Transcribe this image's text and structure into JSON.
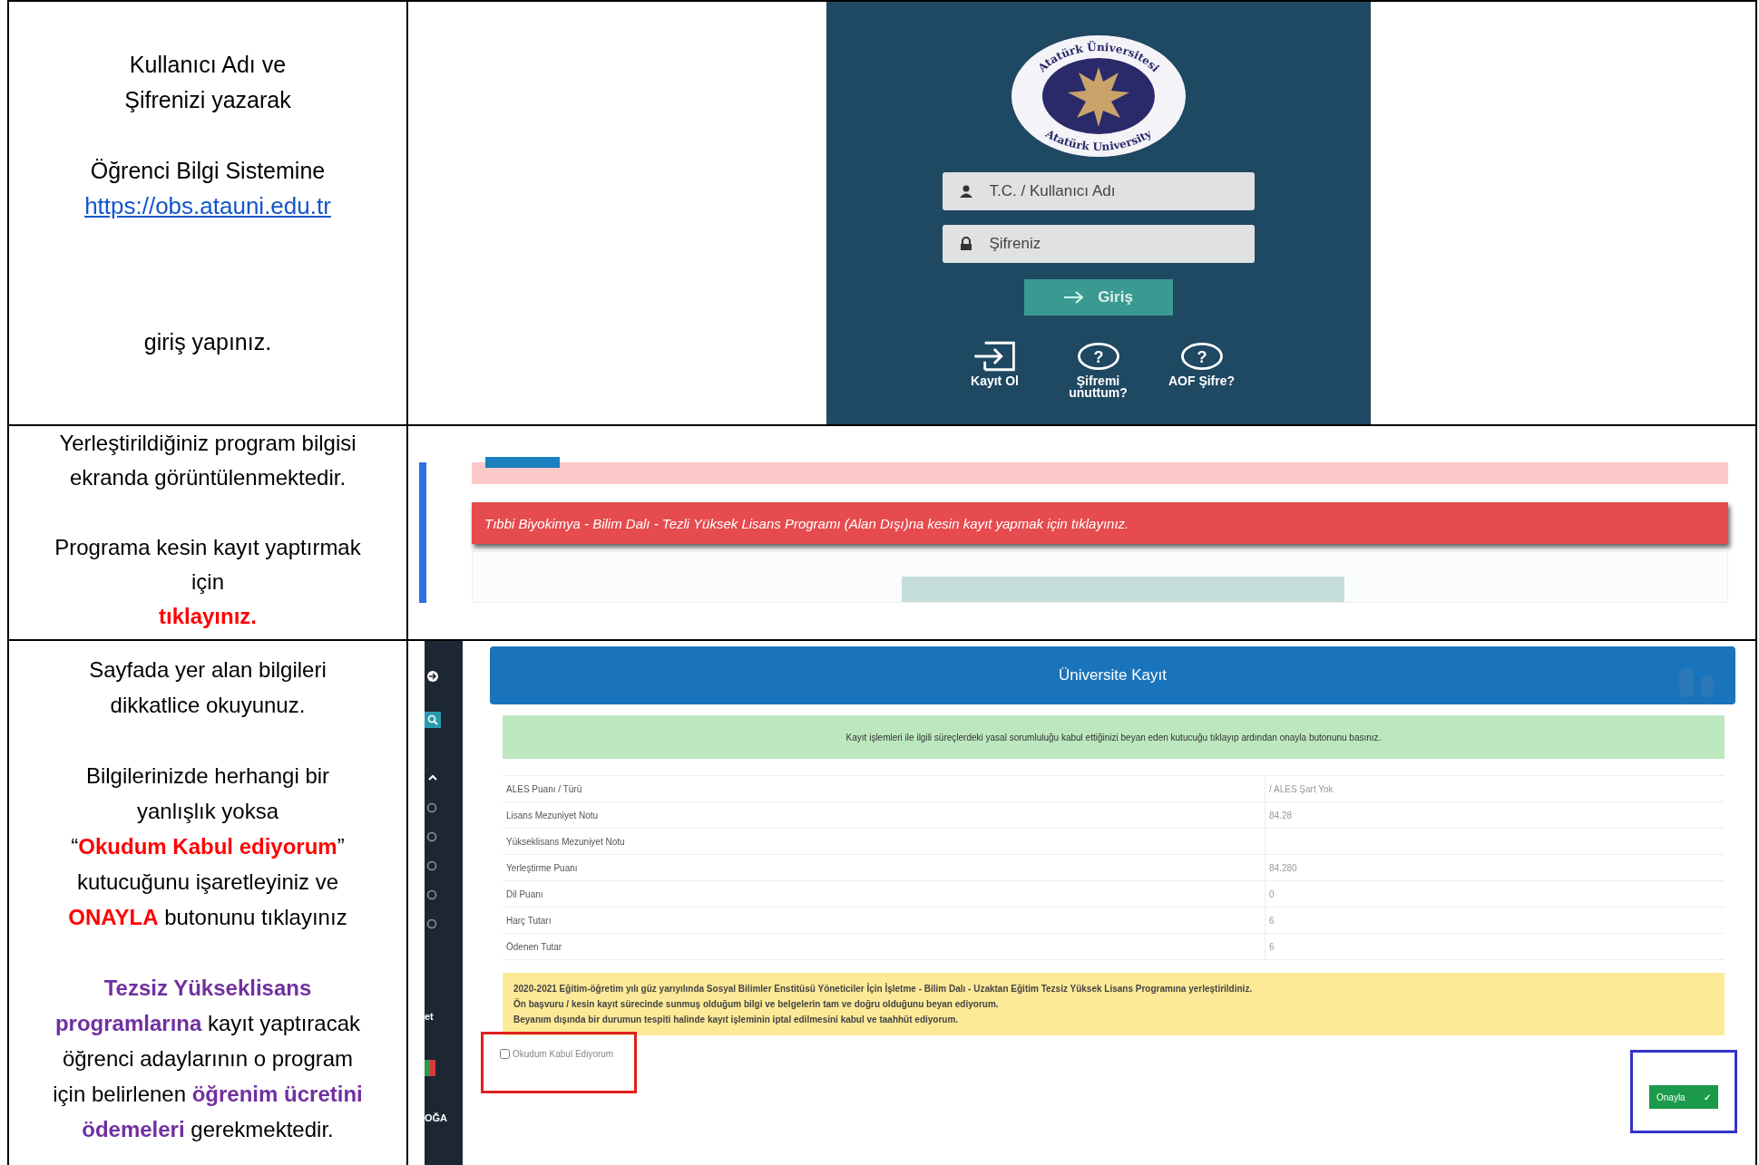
{
  "rows": [
    {
      "instructions": [
        {
          "lines": [
            [
              {
                "kind": "plain",
                "text": "Kullanıcı Adı ve"
              }
            ],
            [
              {
                "kind": "plain",
                "text": "Şifrenizi  yazarak"
              }
            ]
          ]
        },
        {
          "lines": [
            [
              {
                "kind": "plain",
                "text": "Öğrenci Bilgi Sistemine"
              }
            ],
            [
              {
                "kind": "link",
                "text": "https://obs.atauni.edu.tr"
              }
            ]
          ]
        },
        {
          "lines": [
            [
              {
                "kind": "plain",
                "text": "giriş yapınız."
              }
            ]
          ]
        }
      ],
      "login_screen": {
        "logo_top": "Atatürk Üniversitesi",
        "logo_bottom": "Atatürk University",
        "username": {
          "placeholder": "T.C. / Kullanıcı Adı"
        },
        "password": {
          "placeholder": "Şifreniz"
        },
        "login_button": "Giriş",
        "links": [
          {
            "kind": "enter",
            "label": "Kayıt Ol"
          },
          {
            "kind": "help",
            "icon": "?",
            "label": "Şifremi unuttum?"
          },
          {
            "kind": "help",
            "icon": "?",
            "label": "AOF Şifre?"
          }
        ]
      }
    },
    {
      "instructions": [
        {
          "lines": [
            [
              {
                "kind": "plain",
                "text": "Yerleştirildiğiniz program bilgisi"
              }
            ],
            [
              {
                "kind": "plain",
                "text": "ekranda görüntülenmektedir."
              }
            ]
          ]
        },
        {
          "lines": [
            [
              {
                "kind": "plain",
                "text": "Programa kesin kayıt yaptırmak"
              }
            ],
            [
              {
                "kind": "plain",
                "text": "için"
              }
            ],
            [
              {
                "kind": "bold",
                "color": "#ff0000",
                "text": "tıklayınız."
              }
            ]
          ]
        }
      ],
      "program_screen": {
        "banner": "Tıbbi Biyokimya - Bilim Dalı - Tezli Yüksek Lisans Programı (Alan Dışı)na kesin kayıt yapmak için tıklayınız."
      }
    },
    {
      "instructions": [
        {
          "lines": [
            [
              {
                "kind": "plain",
                "text": "Sayfada yer alan bilgileri"
              }
            ],
            [
              {
                "kind": "plain",
                "text": "dikkatlice okuyunuz."
              }
            ]
          ]
        },
        {
          "lines": [
            [
              {
                "kind": "plain",
                "text": "Bilgilerinizde herhangi bir"
              }
            ],
            [
              {
                "kind": "plain",
                "text": "yanlışlık yoksa"
              }
            ],
            [
              {
                "kind": "plain",
                "text": "“"
              },
              {
                "kind": "bold",
                "color": "#ff0000",
                "text": "Okudum Kabul ediyorum"
              },
              {
                "kind": "plain",
                "text": "”"
              }
            ],
            [
              {
                "kind": "plain",
                "text": "kutucuğunu işaretleyiniz ve"
              }
            ],
            [
              {
                "kind": "bold",
                "color": "#ff0000",
                "text": "ONAYLA"
              },
              {
                "kind": "plain",
                "text": " butonunu  tıklayınız"
              }
            ]
          ]
        },
        {
          "lines": [
            [
              {
                "kind": "bold",
                "color": "#7030a0",
                "text": "Tezsiz Yükseklisans"
              }
            ],
            [
              {
                "kind": "bold",
                "color": "#7030a0",
                "text": "programlarına"
              },
              {
                "kind": "plain",
                "text": " kayıt yaptıracak"
              }
            ],
            [
              {
                "kind": "plain",
                "text": "öğrenci adaylarının o program"
              }
            ],
            [
              {
                "kind": "plain",
                "text": "için belirlenen "
              },
              {
                "kind": "bold",
                "color": "#7030a0",
                "text": "öğrenim ücretini"
              }
            ],
            [
              {
                "kind": "bold",
                "color": "#7030a0",
                "text": "ödemeleri"
              },
              {
                "kind": "plain",
                "text": " gerekmektedir."
              }
            ]
          ]
        }
      ],
      "registration_screen": {
        "sidebar_texts": [
          "et",
          "OĞA"
        ],
        "title": "Üniversite Kayıt",
        "notice": "Kayıt işlemleri ile ilgili süreçlerdeki yasal sorumluluğu kabul ettiğinizi beyan eden kutucuğu tıklayıp ardından onayla butonunu basınız.",
        "details": [
          {
            "label": "ALES Puanı / Türü",
            "value": "/ ALES Şart Yok"
          },
          {
            "label": "Lisans Mezuniyet Notu",
            "value": "84.28"
          },
          {
            "label": "Yükseklisans Mezuniyet Notu"
          },
          {
            "label": "Yerleştirme Puanı",
            "value": "84.280"
          },
          {
            "label": "Dil Puanı",
            "value": "0"
          },
          {
            "label": "Harç Tutarı",
            "value": "6"
          },
          {
            "label": "Ödenen Tutar",
            "value": "6"
          }
        ],
        "declaration": [
          "2020-2021 Eğitim-öğretim yılı güz yarıyılında Sosyal Bilimler Enstitüsü Yöneticiler İçin İşletme - Bilim Dalı - Uzaktan Eğitim Tezsiz Yüksek Lisans Programına yerleştirildiniz.",
          "Ön başvuru / kesin kayıt sürecinde sunmuş olduğum bilgi ve belgelerin tam ve doğru olduğunu beyan ediyorum.",
          "Beyanım dışında bir durumun tespiti halinde kayıt işleminin iptal edilmesini kabul ve taahhüt ediyorum."
        ],
        "accept": {
          "label": "Okudum Kabul Ediyorum",
          "checked": false
        },
        "confirm_button": {
          "label": "Onayla",
          "icon": "✓"
        }
      }
    }
  ]
}
